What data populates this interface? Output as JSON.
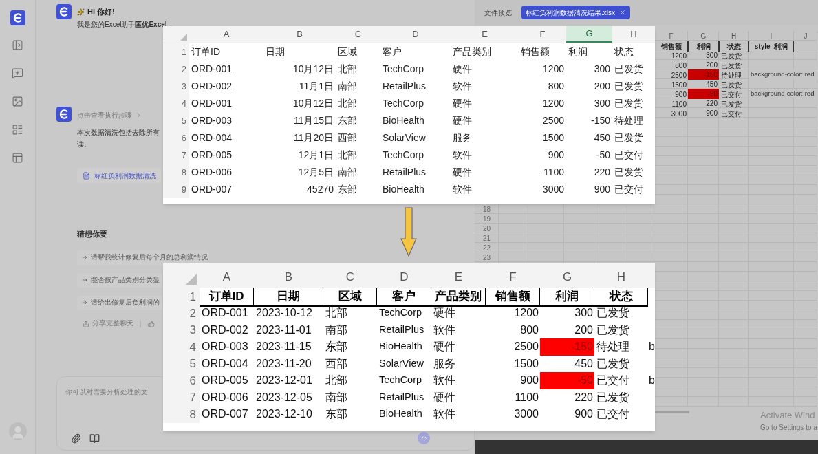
{
  "chat": {
    "greeting": {
      "title": "Hi 你好!",
      "text": "我是您的Excel助手**匡优Excel**，"
    },
    "result": {
      "steps_link": "点击查看执行步骤",
      "text_lines": [
        "本次数据清洗包括去除所有",
        "读。"
      ],
      "file": "标红负利润数据清洗"
    },
    "suggestions": {
      "title": "猜想你要",
      "items": [
        "请帮我统计修复后每个月的总利润情况",
        "能否按产品类别分类显",
        "请给出修复后负利润的"
      ]
    },
    "actions": [
      {
        "label": "分享完整聊天"
      }
    ],
    "input": {
      "placeholder": "你可以对需要分析处理的文"
    }
  },
  "right_panel": {
    "label": "文件预览",
    "file_tab": "标红负利润数据清洗结果.xlsx",
    "sheet": {
      "columns": [
        "F",
        "G",
        "H",
        "I",
        "J"
      ],
      "header": [
        "销售额",
        "利润",
        "状态",
        "style_利润"
      ],
      "rows": [
        {
          "sales": "1200",
          "profit": "300",
          "status": "已发货",
          "highlight": false
        },
        {
          "sales": "800",
          "profit": "200",
          "status": "已发货",
          "highlight": false
        },
        {
          "sales": "2500",
          "profit": "-150",
          "status": "待处理",
          "style": "background-color: red",
          "highlight": true
        },
        {
          "sales": "1500",
          "profit": "450",
          "status": "已发货",
          "highlight": false
        },
        {
          "sales": "900",
          "profit": "-50",
          "status": "已交付",
          "style": "background-color: red",
          "highlight": true
        },
        {
          "sales": "1100",
          "profit": "220",
          "status": "已发货",
          "highlight": false
        },
        {
          "sales": "3000",
          "profit": "900",
          "status": "已交付",
          "highlight": false
        }
      ],
      "row_numbers": [
        "18",
        "19",
        "20",
        "21",
        "22",
        "23"
      ]
    }
  },
  "activation": {
    "title": "Activate Wind",
    "subtitle": "Go to Settings to a"
  },
  "before_sheet": {
    "columns": [
      {
        "label": "A",
        "selected": false
      },
      {
        "label": "B",
        "selected": false
      },
      {
        "label": "C",
        "selected": false
      },
      {
        "label": "D",
        "selected": false
      },
      {
        "label": "E",
        "selected": false
      },
      {
        "label": "F",
        "selected": false
      },
      {
        "label": "G",
        "selected": true
      },
      {
        "label": "H",
        "selected": false
      }
    ],
    "rows": [
      {
        "number": "1",
        "kind": "header",
        "cells": [
          "订单ID",
          "日期",
          "区域",
          "客户",
          "产品类别",
          "销售额",
          "利润",
          "状态"
        ]
      },
      {
        "number": "2",
        "kind": "data",
        "cells": [
          "ORD-001",
          "10月12日",
          "北部",
          "TechCorp",
          "硬件",
          "1200",
          "300",
          "已发货"
        ]
      },
      {
        "number": "3",
        "kind": "data",
        "cells": [
          "ORD-002",
          "11月1日",
          "南部",
          "RetailPlus",
          "软件",
          "800",
          "200",
          "已发货"
        ]
      },
      {
        "number": "4",
        "kind": "data",
        "cells": [
          "ORD-001",
          "10月12日",
          "北部",
          "TechCorp",
          "硬件",
          "1200",
          "300",
          "已发货"
        ]
      },
      {
        "number": "5",
        "kind": "data",
        "cells": [
          "ORD-003",
          "11月15日",
          "东部",
          "BioHealth",
          "硬件",
          "2500",
          "-150",
          "待处理"
        ]
      },
      {
        "number": "6",
        "kind": "data",
        "cells": [
          "ORD-004",
          "11月20日",
          "西部",
          "SolarView",
          "服务",
          "1500",
          "450",
          "已发货"
        ]
      },
      {
        "number": "7",
        "kind": "data",
        "cells": [
          "ORD-005",
          "12月1日",
          "北部",
          "TechCorp",
          "软件",
          "900",
          "-50",
          "已交付"
        ]
      },
      {
        "number": "8",
        "kind": "data",
        "cells": [
          "ORD-006",
          "12月5日",
          "南部",
          "RetailPlus",
          "硬件",
          "1100",
          "220",
          "已发货"
        ]
      },
      {
        "number": "9",
        "kind": "data",
        "cells": [
          "ORD-007",
          "45270",
          "东部",
          "BioHealth",
          "软件",
          "3000",
          "900",
          "已交付"
        ]
      }
    ]
  },
  "after_sheet": {
    "columns": [
      "A",
      "B",
      "C",
      "D",
      "E",
      "F",
      "G",
      "H"
    ],
    "rows": [
      {
        "number": "1",
        "kind": "header",
        "cells": [
          "订单ID",
          "日期",
          "区域",
          "客户",
          "产品类别",
          "销售额",
          "利润",
          "状态"
        ]
      },
      {
        "number": "2",
        "kind": "data",
        "highlight": false,
        "cells": [
          "ORD-001",
          "2023-10-12",
          "北部",
          "TechCorp",
          "硬件",
          "1200",
          "300",
          "已发货"
        ]
      },
      {
        "number": "3",
        "kind": "data",
        "highlight": false,
        "cells": [
          "ORD-002",
          "2023-11-01",
          "南部",
          "RetailPlus",
          "软件",
          "800",
          "200",
          "已发货"
        ]
      },
      {
        "number": "4",
        "kind": "data",
        "highlight": true,
        "overflow": "b",
        "cells": [
          "ORD-003",
          "2023-11-15",
          "东部",
          "BioHealth",
          "硬件",
          "2500",
          "-150",
          "待处理"
        ]
      },
      {
        "number": "5",
        "kind": "data",
        "highlight": false,
        "cells": [
          "ORD-004",
          "2023-11-20",
          "西部",
          "SolarView",
          "服务",
          "1500",
          "450",
          "已发货"
        ]
      },
      {
        "number": "6",
        "kind": "data",
        "highlight": true,
        "overflow": "b",
        "cells": [
          "ORD-005",
          "2023-12-01",
          "北部",
          "TechCorp",
          "软件",
          "900",
          "-50",
          "已交付"
        ]
      },
      {
        "number": "7",
        "kind": "data",
        "highlight": false,
        "cells": [
          "ORD-006",
          "2023-12-05",
          "南部",
          "RetailPlus",
          "硬件",
          "1100",
          "220",
          "已发货"
        ]
      },
      {
        "number": "8",
        "kind": "data",
        "highlight": false,
        "cells": [
          "ORD-007",
          "2023-12-10",
          "东部",
          "BioHealth",
          "软件",
          "3000",
          "900",
          "已交付"
        ]
      }
    ]
  }
}
